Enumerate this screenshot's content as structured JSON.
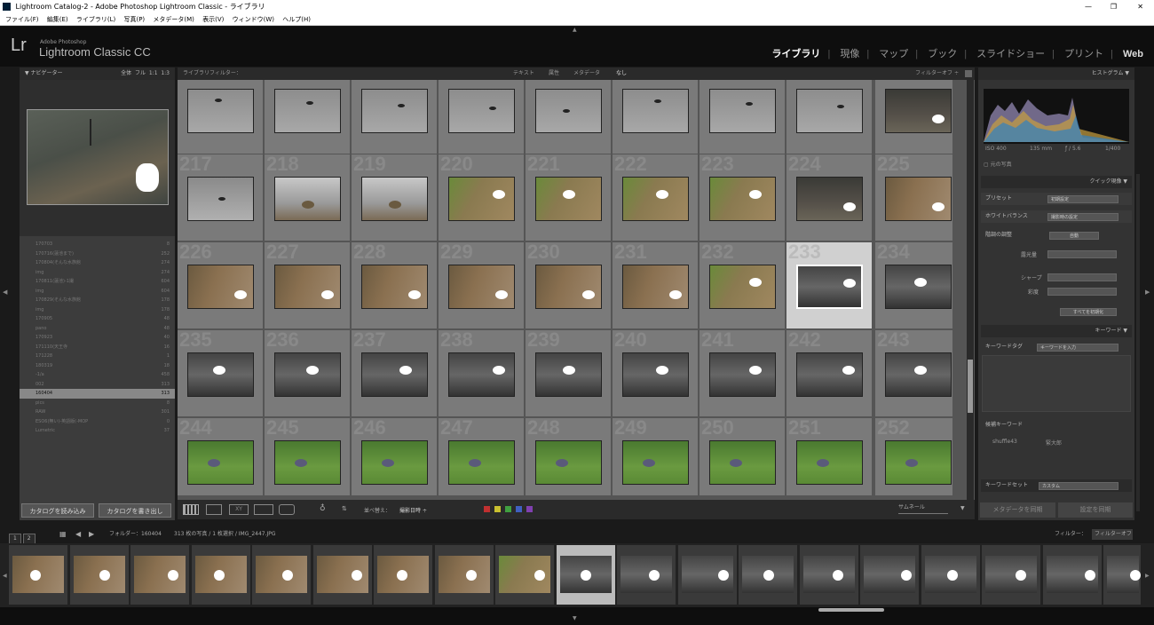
{
  "window": {
    "title": "Lightroom Catalog-2 - Adobe Photoshop Lightroom Classic - ライブラリ",
    "controls": [
      "—",
      "❐",
      "✕"
    ]
  },
  "menu": [
    "ファイル(F)",
    "編集(E)",
    "ライブラリ(L)",
    "写真(P)",
    "メタデータ(M)",
    "表示(V)",
    "ウィンドウ(W)",
    "ヘルプ(H)"
  ],
  "app": {
    "logo": "Lr",
    "vendor": "Adobe Photoshop",
    "name": "Lightroom Classic CC"
  },
  "modules": [
    {
      "label": "ライブラリ",
      "active": true
    },
    {
      "label": "現像",
      "active": false
    },
    {
      "label": "マップ",
      "active": false
    },
    {
      "label": "ブック",
      "active": false
    },
    {
      "label": "スライドショー",
      "active": false
    },
    {
      "label": "プリント",
      "active": false
    },
    {
      "label": "Web",
      "active": false
    }
  ],
  "navigator": {
    "title": "ナビゲーター",
    "zoom": [
      "全体",
      "フル",
      "1:1",
      "1:3"
    ]
  },
  "folders": [
    {
      "name": "170703",
      "count": "8"
    },
    {
      "name": "170716(蓮池まで)",
      "count": "252"
    },
    {
      "name": "170804(そんな水族館",
      "count": "274"
    },
    {
      "name": "img",
      "count": "274"
    },
    {
      "name": "170811(蓮池)-1撮",
      "count": "604"
    },
    {
      "name": "img",
      "count": "604"
    },
    {
      "name": "170829(そんな水族館",
      "count": "178"
    },
    {
      "name": "img",
      "count": "178"
    },
    {
      "name": "170905",
      "count": "48"
    },
    {
      "name": "pano",
      "count": "48"
    },
    {
      "name": "170923",
      "count": "40"
    },
    {
      "name": "171110(天王寺",
      "count": "16"
    },
    {
      "name": "171228",
      "count": "1"
    },
    {
      "name": "180319",
      "count": "18"
    },
    {
      "name": "-1/a",
      "count": "458"
    },
    {
      "name": "002",
      "count": "313"
    },
    {
      "name": "160404",
      "count": "313"
    },
    {
      "name": "pics",
      "count": "8"
    },
    {
      "name": "RAW",
      "count": "301"
    },
    {
      "name": "ESO6(無い)-英語版(-MOP",
      "count": "0"
    },
    {
      "name": "Lumetric",
      "count": "37"
    }
  ],
  "left_buttons": {
    "import": "カタログを読み込み",
    "export": "カタログを書き出し"
  },
  "filter_bar": {
    "label": "ライブラリフィルター：",
    "tabs": [
      "テキスト",
      "属性",
      "メタデータ",
      "なし"
    ],
    "active": "なし",
    "right": "フィルターオフ ÷"
  },
  "grid": [
    {
      "num": "",
      "t": "sky"
    },
    {
      "num": "",
      "t": "sky"
    },
    {
      "num": "",
      "t": "sky"
    },
    {
      "num": "",
      "t": "sky"
    },
    {
      "num": "",
      "t": "sky"
    },
    {
      "num": "",
      "t": "sky"
    },
    {
      "num": "",
      "t": "sky"
    },
    {
      "num": "",
      "t": "sky"
    },
    {
      "num": "",
      "t": "water"
    },
    {
      "num": "217",
      "t": "bird"
    },
    {
      "num": "218",
      "t": "duck"
    },
    {
      "num": "219",
      "t": "duck"
    },
    {
      "num": "220",
      "t": "grass"
    },
    {
      "num": "221",
      "t": "grass"
    },
    {
      "num": "222",
      "t": "grass"
    },
    {
      "num": "223",
      "t": "grass"
    },
    {
      "num": "224",
      "t": "water"
    },
    {
      "num": "225",
      "t": "reed"
    },
    {
      "num": "226",
      "t": "reed"
    },
    {
      "num": "227",
      "t": "reed"
    },
    {
      "num": "228",
      "t": "reed"
    },
    {
      "num": "229",
      "t": "reed"
    },
    {
      "num": "230",
      "t": "reed"
    },
    {
      "num": "231",
      "t": "reed"
    },
    {
      "num": "232",
      "t": "grass"
    },
    {
      "num": "233",
      "t": "rock",
      "sel": true
    },
    {
      "num": "234",
      "t": "rock"
    },
    {
      "num": "235",
      "t": "rock"
    },
    {
      "num": "236",
      "t": "rock"
    },
    {
      "num": "237",
      "t": "rock"
    },
    {
      "num": "238",
      "t": "rock"
    },
    {
      "num": "239",
      "t": "rock"
    },
    {
      "num": "240",
      "t": "rock"
    },
    {
      "num": "241",
      "t": "rock"
    },
    {
      "num": "242",
      "t": "rock"
    },
    {
      "num": "243",
      "t": "rock"
    },
    {
      "num": "244",
      "t": "pigeon"
    },
    {
      "num": "245",
      "t": "pigeon"
    },
    {
      "num": "246",
      "t": "pigeon"
    },
    {
      "num": "247",
      "t": "pigeon"
    },
    {
      "num": "248",
      "t": "pigeon"
    },
    {
      "num": "249",
      "t": "pigeon"
    },
    {
      "num": "250",
      "t": "pigeon"
    },
    {
      "num": "251",
      "t": "pigeon"
    },
    {
      "num": "252",
      "t": "pigeon"
    }
  ],
  "toolbar": {
    "sort_label": "並べ替え：",
    "sort_value": "撮影日時 ÷",
    "thumb_label": "サムネール",
    "colors": [
      "#c03030",
      "#c8c030",
      "#40a040",
      "#4060c0",
      "#8040b0"
    ]
  },
  "histogram": {
    "title": "ヒストグラム",
    "iso": "ISO 400",
    "focal": "135 mm",
    "aperture": "ƒ / 5.6",
    "shutter": "1/400",
    "original": "元の写真"
  },
  "quick_develop": {
    "title": "クイック現像",
    "preset_label": "プリセット",
    "preset_value": "初期設定",
    "wb_label": "ホワイトバランス",
    "wb_value": "撮影時の設定",
    "tone_label": "階調の調整",
    "tone_btn": "自動",
    "exposure": "露光量",
    "sharpen": "シャープ",
    "saturation": "彩度",
    "reset": "すべてを初期化"
  },
  "keywords": {
    "title": "キーワード",
    "tags_label": "キーワードタグ",
    "tags_value": "キーワードを入力",
    "suggest_label": "候補キーワード",
    "suggest": [
      "shuffle43",
      "緊大郎"
    ],
    "set_label": "キーワードセット",
    "set_value": "カスタム"
  },
  "sync": {
    "meta": "メタデータを同期",
    "settings": "設定を同期"
  },
  "filmstrip_bar": {
    "views": [
      "1",
      "2"
    ],
    "folder": "フォルダー：160404",
    "info": "313 枚の写真 / 1 枚選択 / IMG_2447.JPG",
    "filter_label": "フィルター：",
    "filter_value": "フィルターオフ"
  },
  "filmstrip": [
    "reed",
    "reed",
    "reed",
    "reed",
    "reed",
    "reed",
    "reed",
    "reed",
    "grass",
    "rock",
    "rock",
    "rock",
    "rock",
    "rock",
    "rock",
    "rock",
    "rock",
    "rock",
    "rock"
  ]
}
